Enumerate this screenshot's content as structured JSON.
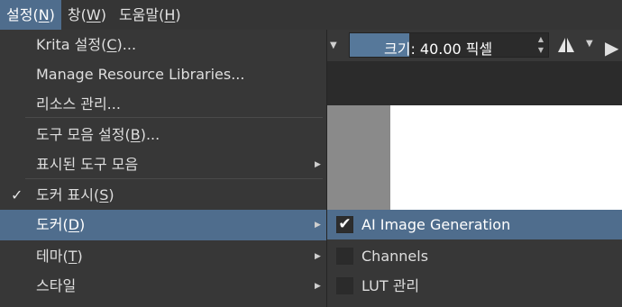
{
  "menubar": {
    "settings": "설정(",
    "settings_key": "N",
    "settings_end": ")",
    "window": "창(",
    "window_key": "W",
    "window_end": ")",
    "help": "도움말(",
    "help_key": "H",
    "help_end": ")"
  },
  "toolbar": {
    "size_label": "크기: 40.00 픽셀",
    "size_fraction": 0.3
  },
  "menu": {
    "items": [
      {
        "pre": "Krita 설정(",
        "key": "C",
        "post": ")..."
      },
      {
        "pre": "Manage Resource Libraries...",
        "key": "",
        "post": ""
      },
      {
        "pre": "리소스 관리...",
        "key": "",
        "post": ""
      },
      {
        "pre": "도구 모음 설정(",
        "key": "B",
        "post": ")..."
      },
      {
        "pre": "표시된 도구 모음",
        "key": "",
        "post": ""
      },
      {
        "pre": "도커 표시(",
        "key": "S",
        "post": ")"
      },
      {
        "pre": "도커(",
        "key": "D",
        "post": ")"
      },
      {
        "pre": "테마(",
        "key": "T",
        "post": ")"
      },
      {
        "pre": "스타일",
        "key": "",
        "post": ""
      }
    ],
    "show_dockers_checked": true
  },
  "submenu": {
    "items": [
      {
        "label": "AI Image Generation",
        "checked": true
      },
      {
        "label": "Channels",
        "checked": false
      },
      {
        "label": "LUT 관리",
        "checked": false
      }
    ]
  },
  "icons": {
    "check": "check-icon",
    "submenu_arrow": "chevron-right-icon",
    "mirror": "mirror-icon",
    "dropdown": "chevron-down-icon"
  },
  "colors": {
    "highlight": "#4f6d8d",
    "menu_bg": "#373737"
  }
}
